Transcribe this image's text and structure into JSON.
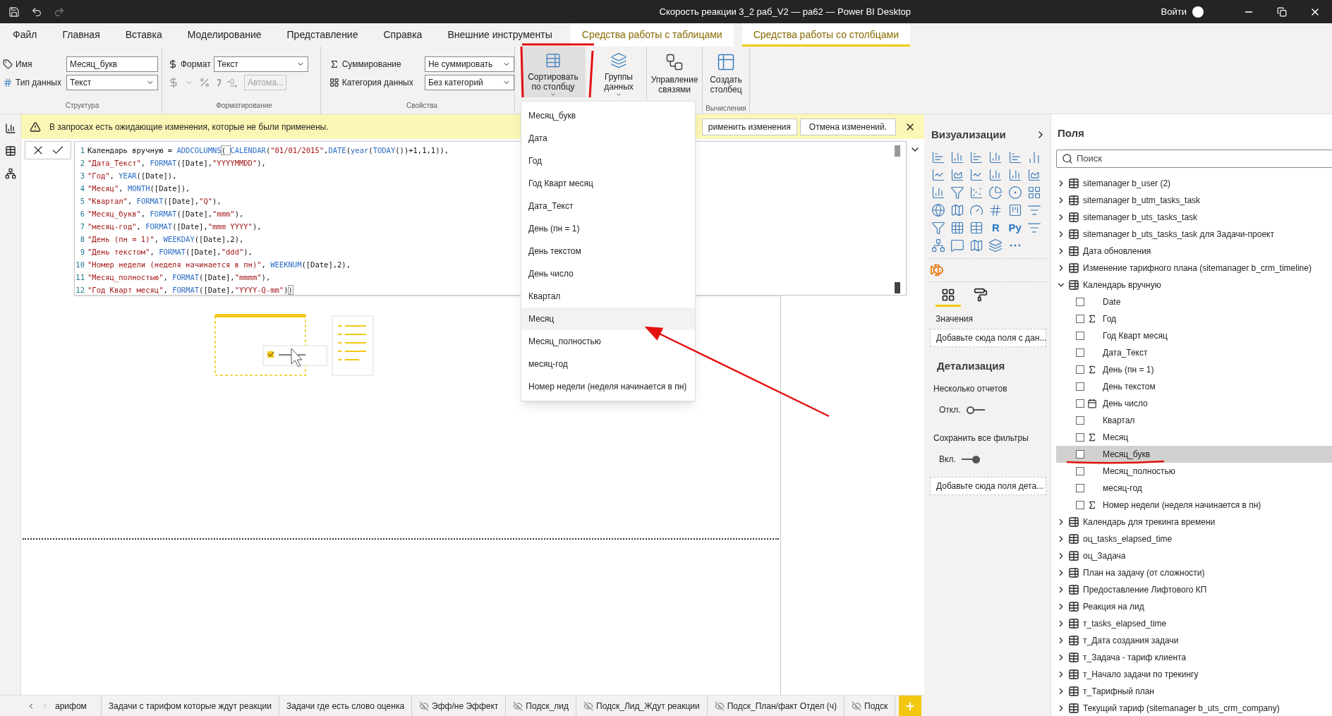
{
  "window": {
    "title": "Скорость реакции 3_2 раб_V2 — ра62 — Power BI Desktop",
    "sign_in": "Войти"
  },
  "menu_tabs": [
    {
      "label": "Файл",
      "contextual": false,
      "selected": false
    },
    {
      "label": "Главная",
      "contextual": false,
      "selected": false
    },
    {
      "label": "Вставка",
      "contextual": false,
      "selected": false
    },
    {
      "label": "Моделирование",
      "contextual": false,
      "selected": false
    },
    {
      "label": "Представление",
      "contextual": false,
      "selected": false
    },
    {
      "label": "Справка",
      "contextual": false,
      "selected": false
    },
    {
      "label": "Внешние инструменты",
      "contextual": false,
      "selected": false
    },
    {
      "label": "Средства работы с таблицами",
      "contextual": true,
      "selected": false
    },
    {
      "label": "Средства работы со столбцами",
      "contextual": true,
      "selected": true
    }
  ],
  "ribbon": {
    "structure": {
      "name_label": "Имя",
      "name_value": "Месяц_букв",
      "type_label": "Тип данных",
      "type_value": "Текст",
      "group_label": "Структура"
    },
    "formatting": {
      "format_label": "Формат",
      "format_value": "Текст",
      "auto_value": "Автома...",
      "group_label": "Форматирование"
    },
    "properties": {
      "summarize_label": "Суммирование",
      "summarize_value": "Не суммировать",
      "category_label": "Категория данных",
      "category_value": "Без категорий",
      "group_label": "Свойства"
    },
    "big_buttons": [
      {
        "kind": "sort",
        "label": "Сортировать по столбцу",
        "has_menu": true,
        "active": true
      },
      {
        "kind": "groups",
        "label": "Группы данных",
        "has_menu": true,
        "active": false
      },
      {
        "kind": "relations",
        "label": "Управление связями",
        "has_menu": false,
        "active": false
      },
      {
        "kind": "new_column",
        "label": "Создать столбец",
        "has_menu": false,
        "active": false
      }
    ],
    "calc_group_label": "Вычисления"
  },
  "warning": {
    "text": "В запросах есть ожидающие изменения, которые не были применены.",
    "buttons": [
      "рименить изменения",
      "Отмена изменений."
    ]
  },
  "editor": {
    "lines": [
      {
        "num": "1",
        "tokens": [
          {
            "kind": "plain",
            "text": "Календарь вручную = "
          },
          {
            "kind": "func",
            "text": "ADDCOLUMNS"
          },
          {
            "kind": "bracket",
            "text": "( "
          },
          {
            "kind": "func",
            "text": "CALENDAR"
          },
          {
            "kind": "plain",
            "text": "("
          },
          {
            "kind": "string",
            "text": "\"01/01/2015\""
          },
          {
            "kind": "plain",
            "text": ","
          },
          {
            "kind": "func",
            "text": "DATE"
          },
          {
            "kind": "plain",
            "text": "("
          },
          {
            "kind": "func",
            "text": "year"
          },
          {
            "kind": "plain",
            "text": "("
          },
          {
            "kind": "func",
            "text": "TODAY"
          },
          {
            "kind": "plain",
            "text": "())+1,1,1)),"
          }
        ]
      },
      {
        "num": "2",
        "tokens": [
          {
            "kind": "string",
            "text": "\"Дата_Текст\""
          },
          {
            "kind": "plain",
            "text": ", "
          },
          {
            "kind": "func",
            "text": "FORMAT"
          },
          {
            "kind": "plain",
            "text": "([Date],"
          },
          {
            "kind": "string",
            "text": "\"YYYYMMDD\""
          },
          {
            "kind": "plain",
            "text": "),"
          }
        ]
      },
      {
        "num": "3",
        "tokens": [
          {
            "kind": "string",
            "text": "\"Год\""
          },
          {
            "kind": "plain",
            "text": ", "
          },
          {
            "kind": "func",
            "text": "YEAR"
          },
          {
            "kind": "plain",
            "text": "([Date]),"
          }
        ]
      },
      {
        "num": "4",
        "tokens": [
          {
            "kind": "string",
            "text": "\"Месяц\""
          },
          {
            "kind": "plain",
            "text": ", "
          },
          {
            "kind": "func",
            "text": "MONTH"
          },
          {
            "kind": "plain",
            "text": "([Date]),"
          }
        ]
      },
      {
        "num": "5",
        "tokens": [
          {
            "kind": "string",
            "text": "\"Квартал\""
          },
          {
            "kind": "plain",
            "text": ", "
          },
          {
            "kind": "func",
            "text": "FORMAT"
          },
          {
            "kind": "plain",
            "text": "([Date],"
          },
          {
            "kind": "string",
            "text": "\"Q\""
          },
          {
            "kind": "plain",
            "text": "),"
          }
        ]
      },
      {
        "num": "6",
        "tokens": [
          {
            "kind": "string",
            "text": "\"Месяц_букв\""
          },
          {
            "kind": "plain",
            "text": ", "
          },
          {
            "kind": "func",
            "text": "FORMAT"
          },
          {
            "kind": "plain",
            "text": "([Date],"
          },
          {
            "kind": "string",
            "text": "\"mmm\""
          },
          {
            "kind": "plain",
            "text": "),"
          }
        ]
      },
      {
        "num": "7",
        "tokens": [
          {
            "kind": "string",
            "text": "\"месяц-год\""
          },
          {
            "kind": "plain",
            "text": ", "
          },
          {
            "kind": "func",
            "text": "FORMAT"
          },
          {
            "kind": "plain",
            "text": "([Date],"
          },
          {
            "kind": "string",
            "text": "\"mmm YYYY\""
          },
          {
            "kind": "plain",
            "text": "),"
          }
        ]
      },
      {
        "num": "8",
        "tokens": [
          {
            "kind": "string",
            "text": "\"День (пн = 1)\""
          },
          {
            "kind": "plain",
            "text": ", "
          },
          {
            "kind": "func",
            "text": "WEEKDAY"
          },
          {
            "kind": "plain",
            "text": "([Date],2),"
          }
        ]
      },
      {
        "num": "9",
        "tokens": [
          {
            "kind": "string",
            "text": "\"День текстом\""
          },
          {
            "kind": "plain",
            "text": ", "
          },
          {
            "kind": "func",
            "text": "FORMAT"
          },
          {
            "kind": "plain",
            "text": "([Date],"
          },
          {
            "kind": "string",
            "text": "\"ddd\""
          },
          {
            "kind": "plain",
            "text": "),"
          }
        ]
      },
      {
        "num": "10",
        "tokens": [
          {
            "kind": "string",
            "text": "\"Номер недели (неделя начинается в пн)\""
          },
          {
            "kind": "plain",
            "text": ", "
          },
          {
            "kind": "func",
            "text": "WEEKNUM"
          },
          {
            "kind": "plain",
            "text": "([Date],2),"
          }
        ]
      },
      {
        "num": "11",
        "tokens": [
          {
            "kind": "string",
            "text": "\"Месяц_полностью\""
          },
          {
            "kind": "plain",
            "text": ", "
          },
          {
            "kind": "func",
            "text": "FORMAT"
          },
          {
            "kind": "plain",
            "text": "([Date],"
          },
          {
            "kind": "string",
            "text": "\"mmmm\""
          },
          {
            "kind": "plain",
            "text": "),"
          }
        ]
      },
      {
        "num": "12",
        "tokens": [
          {
            "kind": "string",
            "text": "\"Год Кварт месяц\""
          },
          {
            "kind": "plain",
            "text": ", "
          },
          {
            "kind": "func",
            "text": "FORMAT"
          },
          {
            "kind": "plain",
            "text": "([Date],"
          },
          {
            "kind": "string",
            "text": "\"YYYY-Q-mm\""
          },
          {
            "kind": "plain",
            "text": ")"
          },
          {
            "kind": "bracket",
            "text": ")"
          }
        ]
      }
    ]
  },
  "sort_menu": {
    "items": [
      {
        "label": "Месяц_букв",
        "highlighted": false
      },
      {
        "label": "Дата",
        "highlighted": false
      },
      {
        "label": "Год",
        "highlighted": false
      },
      {
        "label": "Год Кварт месяц",
        "highlighted": false
      },
      {
        "label": "Дата_Текст",
        "highlighted": false
      },
      {
        "label": "День (пн = 1)",
        "highlighted": false
      },
      {
        "label": "День текстом",
        "highlighted": false
      },
      {
        "label": "День число",
        "highlighted": false
      },
      {
        "label": "Квартал",
        "highlighted": false
      },
      {
        "label": "Месяц",
        "highlighted": true
      },
      {
        "label": "Месяц_полностью",
        "highlighted": false
      },
      {
        "label": "месяц-год",
        "highlighted": false
      },
      {
        "label": "Номер недели (неделя начинается в пн)",
        "highlighted": false
      }
    ]
  },
  "visualizations": {
    "title": "Визуализации",
    "letter_icons": [
      "R",
      "Py"
    ],
    "pane_tabs": [
      {
        "kind": "fields",
        "selected": true
      },
      {
        "kind": "format",
        "selected": false
      }
    ],
    "values_label": "Значения",
    "values_well": "Добавьте сюда поля с дан...",
    "drillthrough_title": "Детализация",
    "toggles": [
      {
        "label": "Несколько отчетов",
        "state_text": "Откл.",
        "on": false
      },
      {
        "label": "Сохранить все фильтры",
        "state_text": "Вкл.",
        "on": true
      }
    ],
    "drill_well": "Добавьте сюда поля дета..."
  },
  "fields": {
    "title": "Поля",
    "search_placeholder": "Поиск",
    "tables": [
      {
        "name": "sitemanager b_user (2)",
        "kind": "table",
        "expanded": false
      },
      {
        "name": "sitemanager b_utm_tasks_task",
        "kind": "table",
        "expanded": false
      },
      {
        "name": "sitemanager b_uts_tasks_task",
        "kind": "table",
        "expanded": false
      },
      {
        "name": "sitemanager b_uts_tasks_task для Задачи-проект",
        "kind": "table",
        "expanded": false
      },
      {
        "name": "Дата обновления",
        "kind": "table",
        "expanded": false
      },
      {
        "name": "Изменение тарифного плана (sitemanager b_crm_timeline)",
        "kind": "table",
        "expanded": false
      },
      {
        "name": "Календарь вручную",
        "kind": "calc",
        "expanded": true,
        "children": [
          {
            "name": "Date",
            "kind": "plain",
            "checked": false,
            "selected": false
          },
          {
            "name": "Год",
            "kind": "sum",
            "checked": false,
            "selected": false
          },
          {
            "name": "Год Кварт месяц",
            "kind": "plain",
            "checked": false,
            "selected": false
          },
          {
            "name": "Дата_Текст",
            "kind": "plain",
            "checked": false,
            "selected": false
          },
          {
            "name": "День (пн = 1)",
            "kind": "sum",
            "checked": false,
            "selected": false
          },
          {
            "name": "День текстом",
            "kind": "plain",
            "checked": false,
            "selected": false
          },
          {
            "name": "День число",
            "kind": "hier",
            "checked": false,
            "selected": false
          },
          {
            "name": "Квартал",
            "kind": "plain",
            "checked": false,
            "selected": false
          },
          {
            "name": "Месяц",
            "kind": "sum",
            "checked": false,
            "selected": false
          },
          {
            "name": "Месяц_букв",
            "kind": "plain",
            "checked": false,
            "selected": true
          },
          {
            "name": "Месяц_полностью",
            "kind": "plain",
            "checked": false,
            "selected": false
          },
          {
            "name": "месяц-год",
            "kind": "plain",
            "checked": false,
            "selected": false
          },
          {
            "name": "Номер недели (неделя начинается в пн)",
            "kind": "sum",
            "checked": false,
            "selected": false
          }
        ]
      },
      {
        "name": "Календарь для трекинга времени",
        "kind": "calc",
        "expanded": false
      },
      {
        "name": "оц_tasks_elapsed_time",
        "kind": "table",
        "expanded": false
      },
      {
        "name": "оц_Задача",
        "kind": "table",
        "expanded": false
      },
      {
        "name": "План на задачу (от сложности)",
        "kind": "calc",
        "expanded": false
      },
      {
        "name": "Предоставление Лифтового КП",
        "kind": "table",
        "expanded": false
      },
      {
        "name": "Реакция на лид",
        "kind": "table",
        "expanded": false
      },
      {
        "name": "т_tasks_elapsed_time",
        "kind": "table",
        "expanded": false
      },
      {
        "name": "т_Дата создания задачи",
        "kind": "table",
        "expanded": false
      },
      {
        "name": "т_Задача - тариф клиента",
        "kind": "table",
        "expanded": false
      },
      {
        "name": "т_Начало задачи по трекингу",
        "kind": "table",
        "expanded": false
      },
      {
        "name": "т_Тарифный план",
        "kind": "table",
        "expanded": false
      },
      {
        "name": "Текущий тариф (sitemanager b_uts_crm_company)",
        "kind": "table",
        "expanded": false
      }
    ]
  },
  "sheet_tabs": [
    {
      "label": "арифом",
      "hidden": false
    },
    {
      "label": "Задачи с тарифом которые ждут реакции",
      "hidden": false
    },
    {
      "label": "Задачи где есть слово оценка",
      "hidden": false
    },
    {
      "label": "Эфф/не Эффект",
      "hidden": true
    },
    {
      "label": "Подск_лид",
      "hidden": true
    },
    {
      "label": "Подск_Лид_Ждут реакции",
      "hidden": true
    },
    {
      "label": "Подск_План/факт Отдел (ч)",
      "hidden": true
    },
    {
      "label": "Подск",
      "hidden": true
    }
  ]
}
